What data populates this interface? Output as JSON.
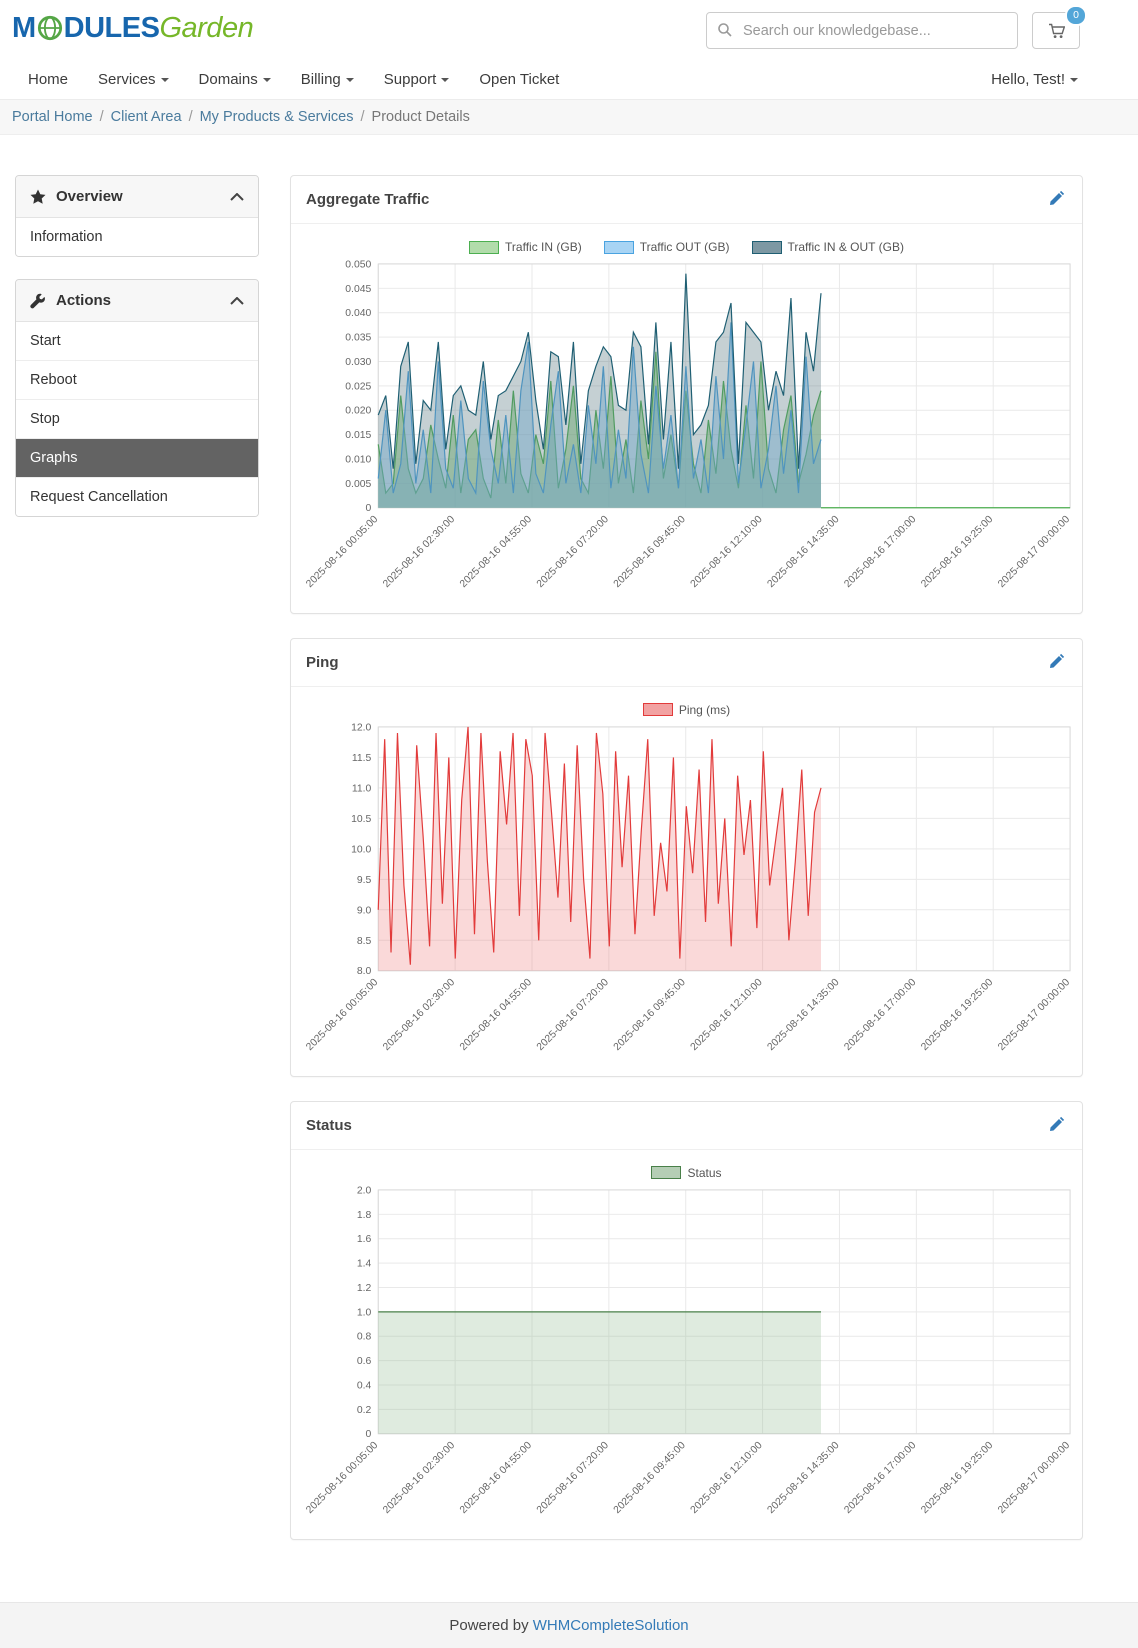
{
  "header": {
    "logo": {
      "part1": "M",
      "part2": "DULES",
      "part3": "Garden"
    },
    "search": {
      "placeholder": "Search our knowledgebase..."
    },
    "cart_count": "0"
  },
  "nav": {
    "items": [
      {
        "label": "Home"
      },
      {
        "label": "Services"
      },
      {
        "label": "Domains"
      },
      {
        "label": "Billing"
      },
      {
        "label": "Support"
      },
      {
        "label": "Open Ticket"
      }
    ],
    "user_menu": "Hello, Test!"
  },
  "breadcrumb": {
    "items": [
      "Portal Home",
      "Client Area",
      "My Products & Services",
      "Product Details"
    ]
  },
  "sidebar": {
    "overview": {
      "title": "Overview",
      "items": [
        {
          "label": "Information"
        }
      ]
    },
    "actions": {
      "title": "Actions",
      "items": [
        {
          "label": "Start"
        },
        {
          "label": "Reboot"
        },
        {
          "label": "Stop"
        },
        {
          "label": "Graphs",
          "active": true
        },
        {
          "label": "Request Cancellation"
        }
      ]
    }
  },
  "footer": {
    "text": "Powered by",
    "link_label": "WHMCompleteSolution"
  },
  "chart_data": [
    {
      "type": "area",
      "title": "Aggregate Traffic",
      "x_labels": [
        "2025-08-16 00:05:00",
        "2025-08-16 02:30:00",
        "2025-08-16 04:55:00",
        "2025-08-16 07:20:00",
        "2025-08-16 09:45:00",
        "2025-08-16 12:10:00",
        "2025-08-16 14:35:00",
        "2025-08-16 17:00:00",
        "2025-08-16 19:25:00",
        "2025-08-17 00:00:00"
      ],
      "ylim": [
        0,
        0.05
      ],
      "ytick_labels": [
        "0",
        "0.005",
        "0.010",
        "0.015",
        "0.020",
        "0.025",
        "0.030",
        "0.035",
        "0.040",
        "0.045",
        "0.050"
      ],
      "grid": true,
      "legend_position": "top",
      "data_end_fraction": 0.64,
      "extend_zero_to_end": true,
      "series": [
        {
          "name": "Traffic IN (GB)",
          "stroke": "#4caf50",
          "fill": "rgba(134,198,123,0.55)",
          "legend_fill": "#b2dcab",
          "values_scale": 0.001,
          "values": [
            13,
            3,
            5,
            23,
            8,
            3,
            6,
            17,
            10,
            4,
            19,
            3,
            14,
            16,
            6,
            2,
            18,
            5,
            24,
            7,
            3,
            15,
            9,
            26,
            4,
            12,
            25,
            6,
            3,
            20,
            8,
            27,
            5,
            14,
            3,
            22,
            10,
            32,
            6,
            15,
            4,
            24,
            9,
            3,
            18,
            7,
            26,
            12,
            4,
            21,
            6,
            30,
            8,
            3,
            16,
            23,
            5,
            11,
            19,
            24
          ]
        },
        {
          "name": "Traffic OUT (GB)",
          "stroke": "#4aa3e0",
          "fill": "rgba(125,190,240,0.45)",
          "legend_fill": "#a8d4f4",
          "values_scale": 0.001,
          "values": [
            6,
            20,
            3,
            9,
            28,
            5,
            16,
            3,
            30,
            8,
            4,
            22,
            6,
            3,
            26,
            12,
            5,
            19,
            3,
            24,
            34,
            7,
            3,
            17,
            28,
            5,
            13,
            3,
            21,
            9,
            29,
            4,
            16,
            6,
            33,
            11,
            3,
            25,
            8,
            19,
            4,
            29,
            6,
            14,
            3,
            27,
            10,
            38,
            5,
            17,
            30,
            4,
            12,
            25,
            7,
            20,
            3,
            31,
            9,
            14
          ]
        },
        {
          "name": "Traffic IN & OUT (GB)",
          "stroke": "#1f5f73",
          "fill": "rgba(90,120,130,0.35)",
          "legend_fill": "#7d98a3",
          "values_scale": 0.001,
          "values": [
            19,
            23,
            8,
            29,
            34,
            9,
            22,
            20,
            34,
            12,
            23,
            25,
            20,
            19,
            30,
            14,
            23,
            24,
            27,
            30,
            36,
            22,
            12,
            32,
            31,
            17,
            34,
            9,
            24,
            29,
            33,
            31,
            21,
            20,
            36,
            33,
            13,
            38,
            14,
            34,
            8,
            48,
            15,
            17,
            21,
            34,
            36,
            42,
            9,
            38,
            36,
            34,
            20,
            28,
            23,
            43,
            8,
            36,
            28,
            44
          ]
        }
      ]
    },
    {
      "type": "area",
      "title": "Ping",
      "x_labels": [
        "2025-08-16 00:05:00",
        "2025-08-16 02:30:00",
        "2025-08-16 04:55:00",
        "2025-08-16 07:20:00",
        "2025-08-16 09:45:00",
        "2025-08-16 12:10:00",
        "2025-08-16 14:35:00",
        "2025-08-16 17:00:00",
        "2025-08-16 19:25:00",
        "2025-08-17 00:00:00"
      ],
      "ylim": [
        8,
        12
      ],
      "ytick_labels": [
        "8.0",
        "8.5",
        "9.0",
        "9.5",
        "10.0",
        "10.5",
        "11.0",
        "11.5",
        "12.0"
      ],
      "grid": true,
      "legend_position": "top",
      "data_end_fraction": 0.64,
      "extend_zero_to_end": false,
      "series": [
        {
          "name": "Ping (ms)",
          "stroke": "#e23b3b",
          "fill": "rgba(240,128,128,0.30)",
          "legend_fill": "#f2a2a2",
          "values": [
            9.0,
            11.8,
            8.3,
            11.9,
            9.4,
            8.1,
            11.7,
            10.2,
            8.4,
            11.9,
            9.1,
            11.5,
            8.2,
            10.8,
            12.0,
            8.6,
            11.9,
            9.8,
            8.3,
            11.6,
            10.4,
            11.9,
            8.9,
            11.8,
            11.2,
            8.5,
            11.9,
            10.6,
            9.2,
            11.4,
            8.8,
            11.7,
            9.5,
            8.2,
            11.9,
            10.9,
            8.4,
            11.6,
            9.7,
            11.2,
            8.6,
            10.3,
            11.8,
            8.9,
            10.1,
            9.3,
            11.5,
            8.2,
            10.7,
            9.6,
            11.3,
            8.8,
            11.8,
            9.1,
            10.5,
            8.4,
            11.2,
            9.9,
            10.8,
            8.7,
            11.6,
            9.4,
            10.2,
            11.0,
            8.5,
            9.8,
            11.3,
            8.9,
            10.6,
            11.0
          ]
        }
      ]
    },
    {
      "type": "area",
      "title": "Status",
      "x_labels": [
        "2025-08-16 00:05:00",
        "2025-08-16 02:30:00",
        "2025-08-16 04:55:00",
        "2025-08-16 07:20:00",
        "2025-08-16 09:45:00",
        "2025-08-16 12:10:00",
        "2025-08-16 14:35:00",
        "2025-08-16 17:00:00",
        "2025-08-16 19:25:00",
        "2025-08-17 00:00:00"
      ],
      "ylim": [
        0,
        2
      ],
      "ytick_labels": [
        "0",
        "0.2",
        "0.4",
        "0.6",
        "0.8",
        "1.0",
        "1.2",
        "1.4",
        "1.6",
        "1.8",
        "2.0"
      ],
      "grid": true,
      "legend_position": "top",
      "data_end_fraction": 0.64,
      "extend_zero_to_end": false,
      "series": [
        {
          "name": "Status",
          "stroke": "#498049",
          "fill": "rgba(150,190,150,0.30)",
          "legend_fill": "#b5ceb5",
          "values": [
            1,
            1
          ]
        }
      ]
    }
  ]
}
